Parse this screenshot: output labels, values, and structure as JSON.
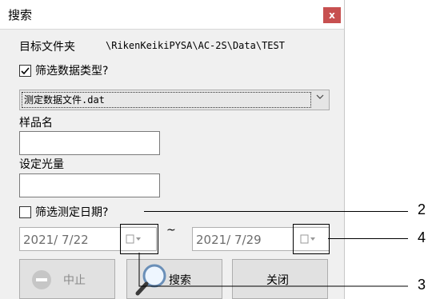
{
  "dialog": {
    "title": "搜索",
    "close_label": "x",
    "target_folder_label": "目标文件夹",
    "target_folder_path": "\\RikenKeikiPYSA\\AC-2S\\Data\\TEST",
    "filter_type_label": "筛选数据类型?",
    "filter_type_checked": true,
    "file_type_selected": "测定数据文件.dat",
    "sample_name_label": "样品名",
    "sample_name_value": "",
    "light_amount_label": "设定光量",
    "light_amount_value": "",
    "filter_date_label": "筛选测定日期?",
    "filter_date_checked": false,
    "date_from": "2021/  7/22",
    "date_separator": "~",
    "date_to": "2021/  7/29",
    "stop_button_label": "中止",
    "search_button_label": "搜索",
    "close_button_label": "关闭"
  },
  "callouts": {
    "label_2": "2",
    "label_3": "3",
    "label_4": "4"
  }
}
